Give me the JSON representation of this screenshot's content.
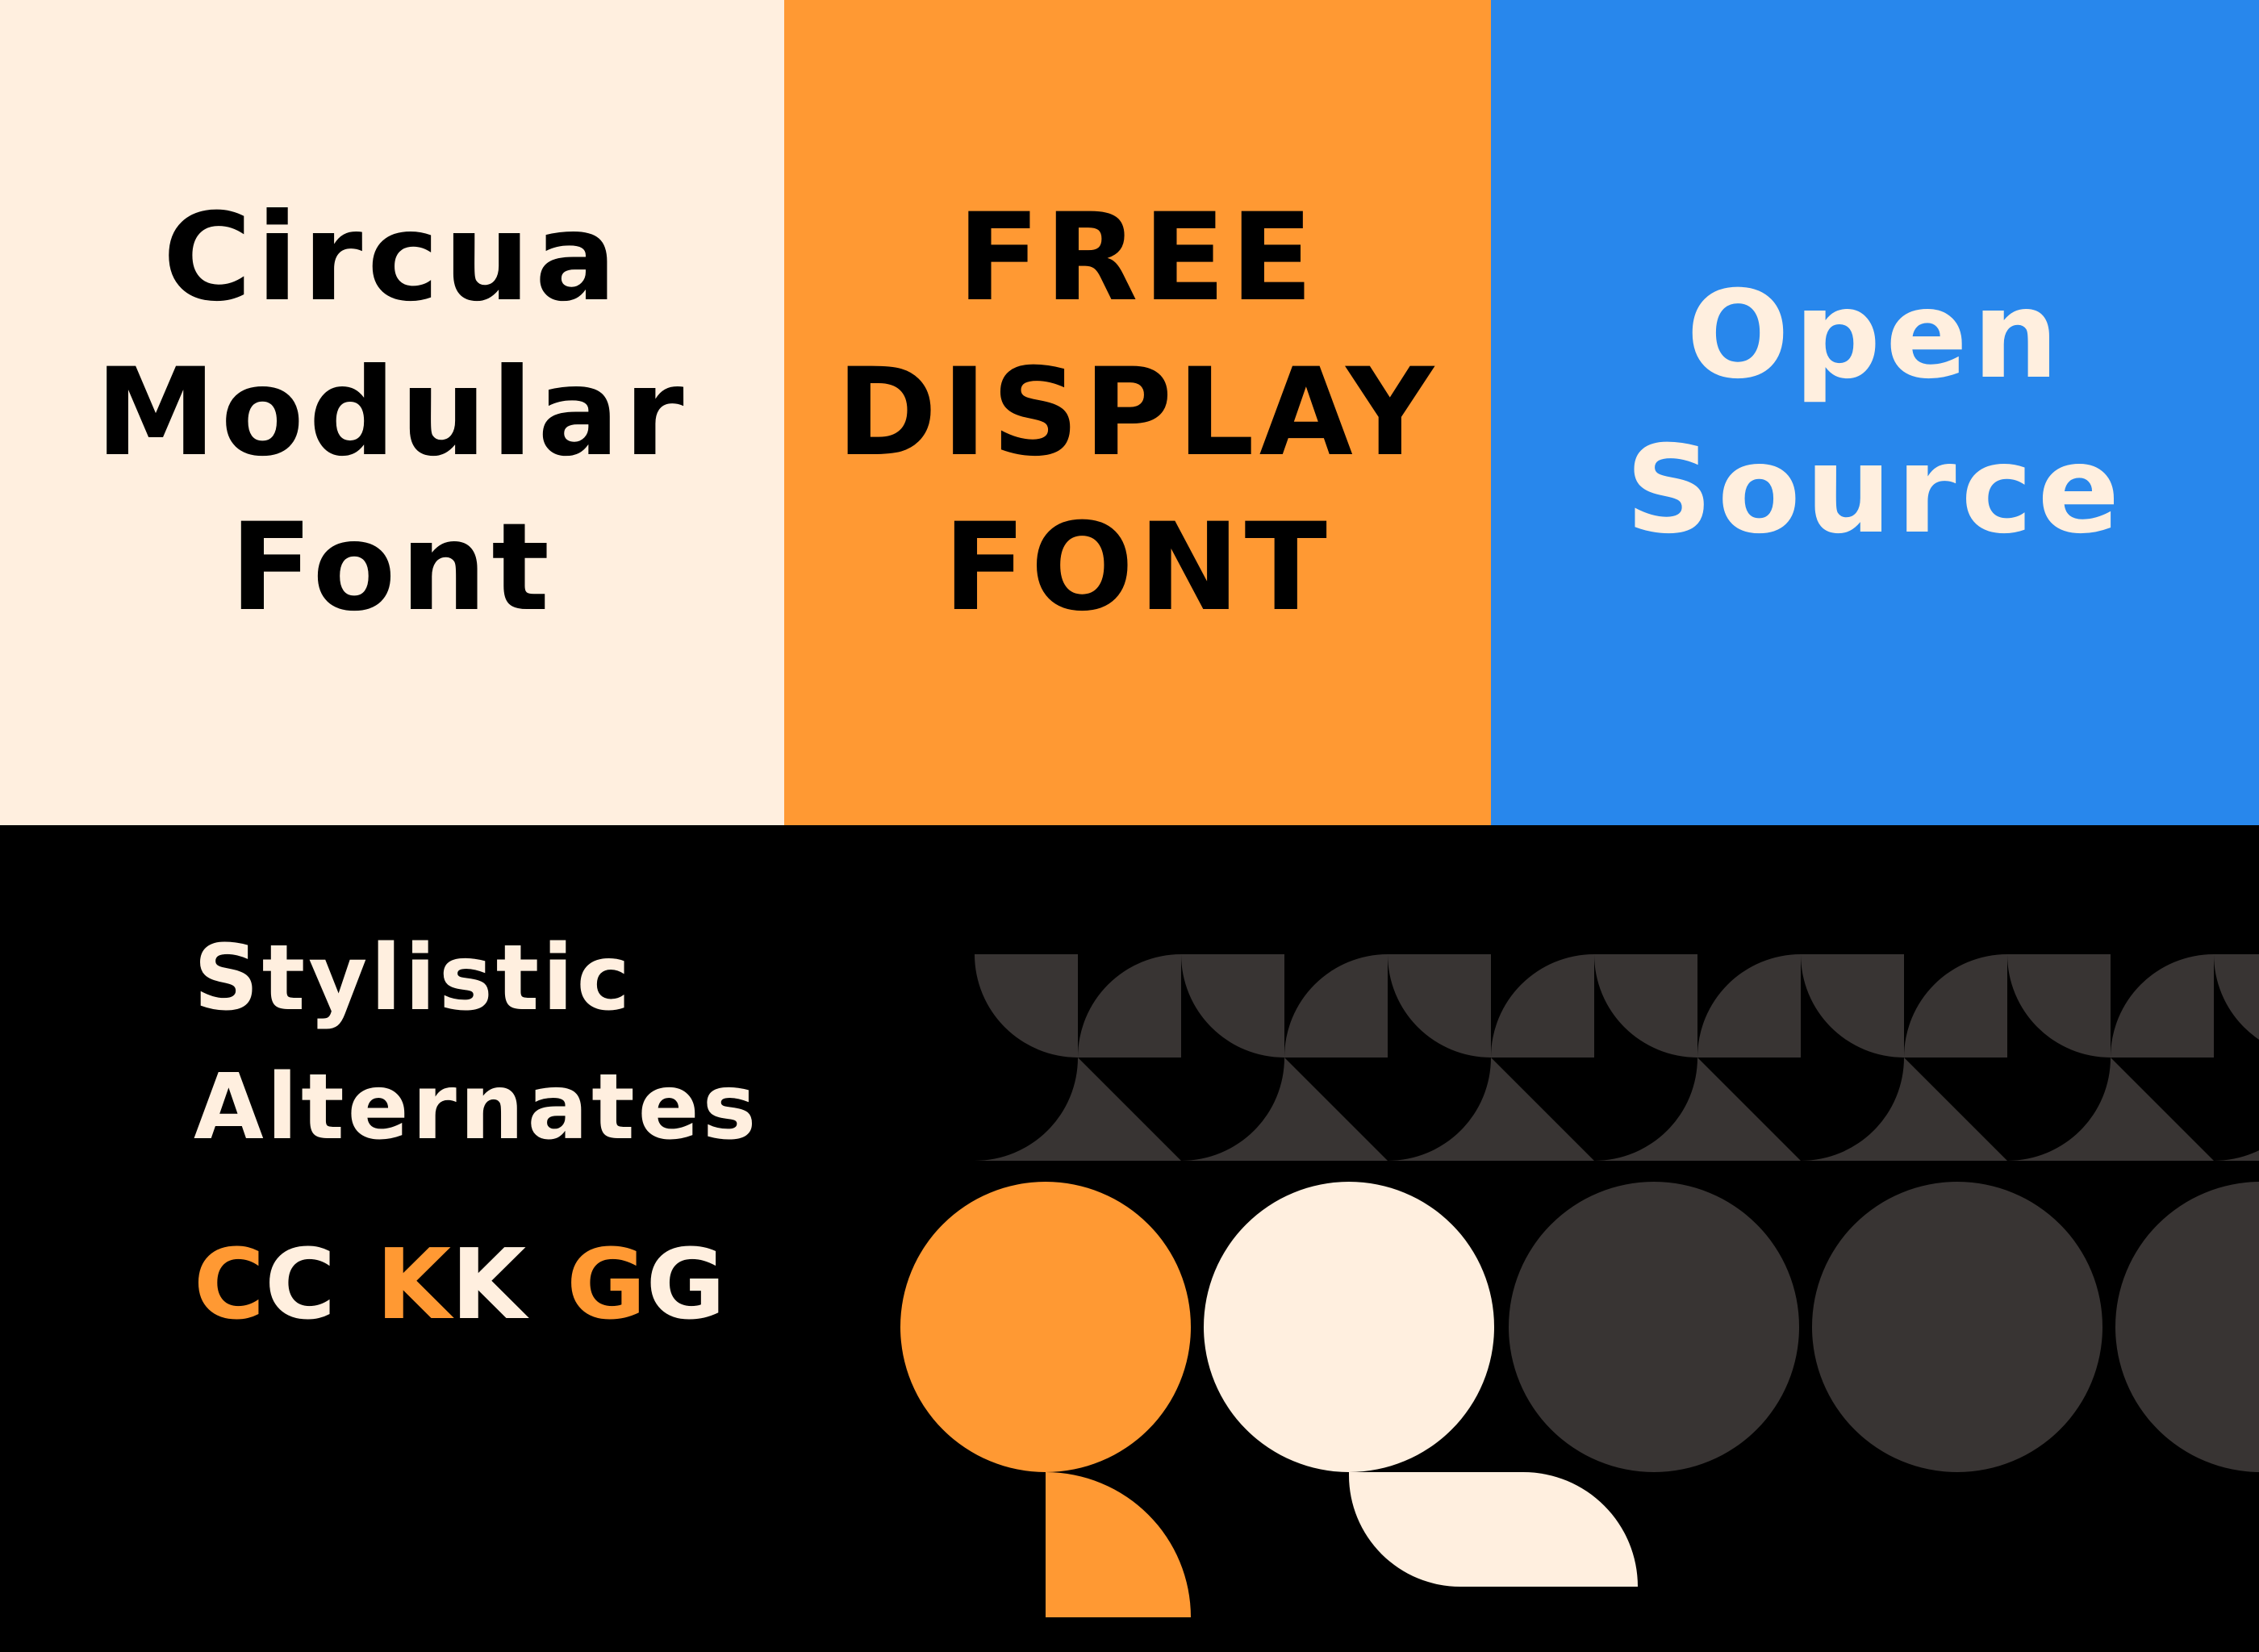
{
  "colors": {
    "cream": "#FFEFDF",
    "orange": "#FF9933",
    "blue": "#2887EC",
    "dark": "#383433",
    "black": "#000000"
  },
  "panels": {
    "cream": {
      "lines": [
        "Circua",
        "Modular",
        "Font"
      ]
    },
    "orange": {
      "lines": [
        "FREE",
        "DISPLAY",
        "FONT"
      ]
    },
    "blue": {
      "lines": [
        "Open",
        "Source"
      ]
    }
  },
  "stylistic": {
    "lines": [
      "Stylistic",
      "Alternates"
    ],
    "alternates": [
      {
        "default": "C",
        "alt": "C"
      },
      {
        "default": "K",
        "alt": "K"
      },
      {
        "default": "G",
        "alt": "G"
      }
    ]
  }
}
